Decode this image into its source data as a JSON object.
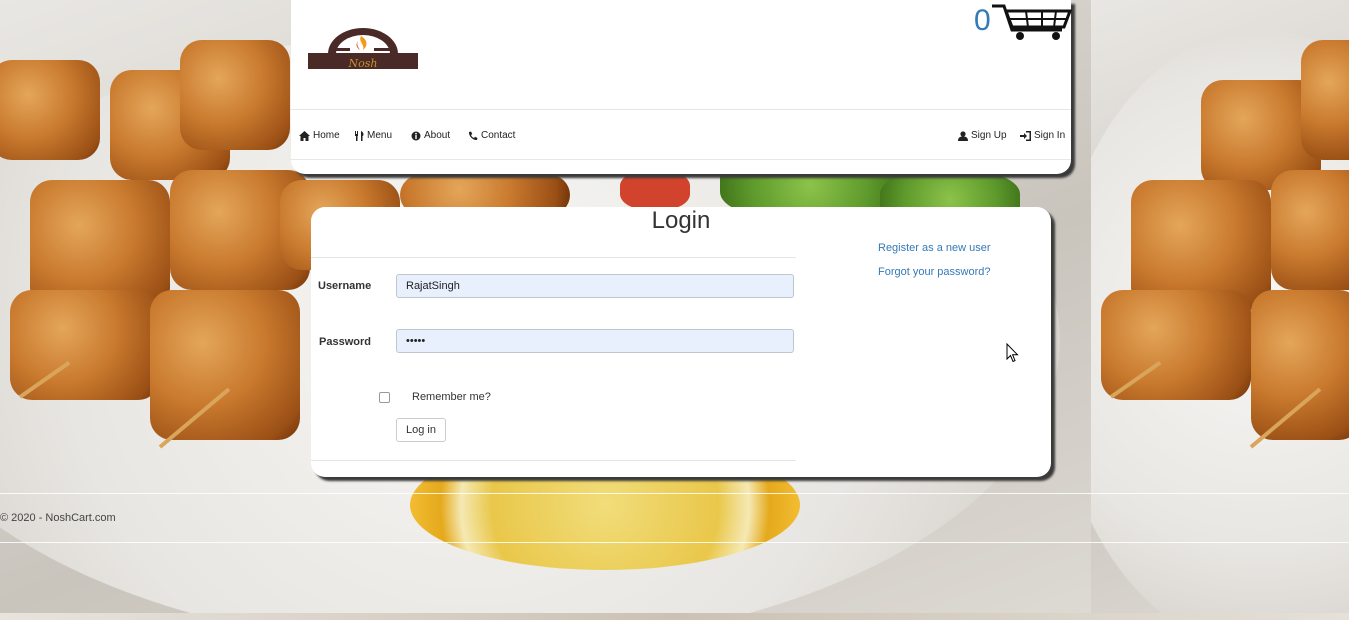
{
  "brand": {
    "logo_text": "Nosh"
  },
  "cart": {
    "count": "0"
  },
  "nav": {
    "left": [
      {
        "label": "Home",
        "icon": "home-icon"
      },
      {
        "label": "Menu",
        "icon": "cutlery-icon"
      },
      {
        "label": "About",
        "icon": "info-icon"
      },
      {
        "label": "Contact",
        "icon": "phone-icon"
      }
    ],
    "right": [
      {
        "label": "Sign Up",
        "icon": "user-icon"
      },
      {
        "label": "Sign In",
        "icon": "sign-in-icon"
      }
    ]
  },
  "login": {
    "title": "Login",
    "username_label": "Username",
    "username_value": "RajatSingh",
    "password_label": "Password",
    "password_value": "•••••",
    "remember_label": "Remember me?",
    "remember_checked": false,
    "submit_label": "Log in",
    "register_link": "Register as a new user",
    "forgot_link": "Forgot your password?"
  },
  "footer": {
    "copyright": "© 2020 - NoshCart.com"
  },
  "colors": {
    "link": "#337ab7",
    "logo_bg": "#4a2a26",
    "logo_flame": "#f39a1c",
    "input_bg": "#e8f0fe"
  }
}
